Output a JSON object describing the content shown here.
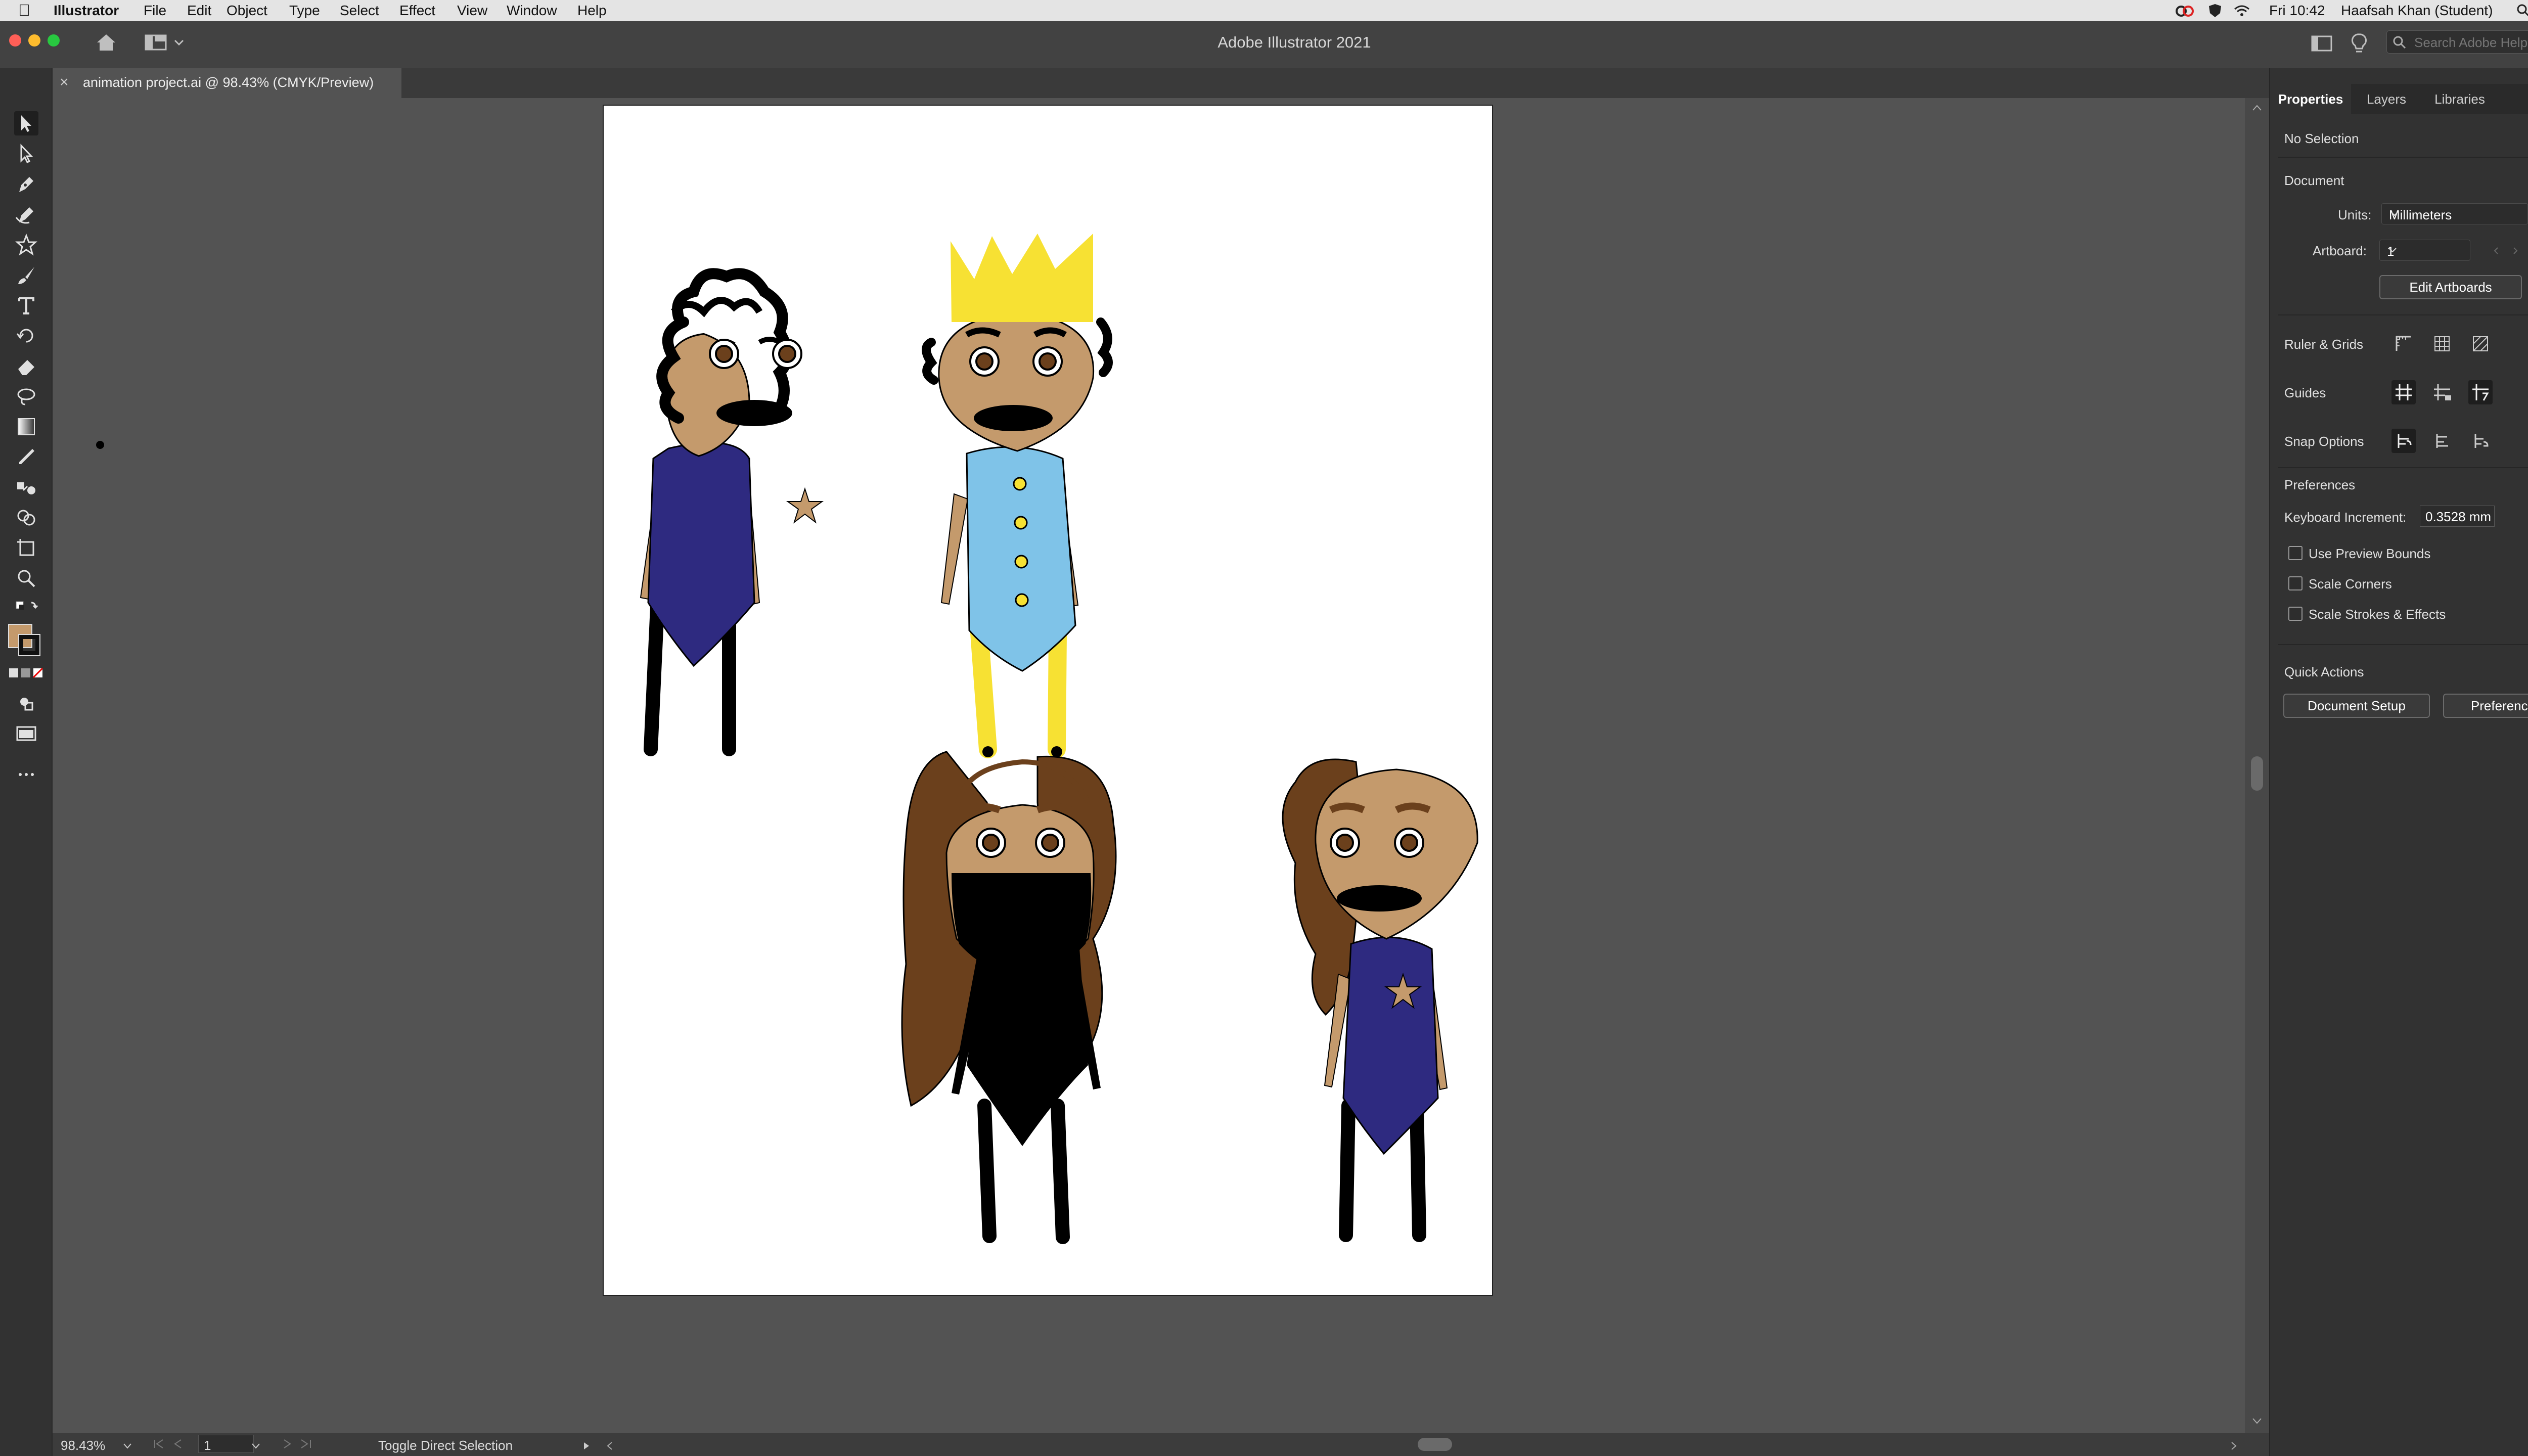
{
  "menubar": {
    "app": "Illustrator",
    "items": [
      "File",
      "Edit",
      "Object",
      "Type",
      "Select",
      "Effect",
      "View",
      "Window",
      "Help"
    ],
    "clock": "Fri 10:42",
    "user": "Haafsah Khan (Student)"
  },
  "window": {
    "title": "Adobe Illustrator 2021",
    "help_search_placeholder": "Search Adobe Help"
  },
  "document_tab": {
    "title": "animation project.ai @ 98.43% (CMYK/Preview)"
  },
  "tools": [
    "selection",
    "direct-selection",
    "pen",
    "curvature",
    "star",
    "paintbrush",
    "type",
    "rotate",
    "eraser",
    "lasso",
    "gradient",
    "eyedropper",
    "blend",
    "shape-builder",
    "artboard",
    "zoom"
  ],
  "panel": {
    "tabs": [
      "Properties",
      "Layers",
      "Libraries"
    ],
    "selection": "No Selection",
    "document": {
      "heading": "Document",
      "units_label": "Units:",
      "units_value": "Millimeters",
      "artboard_label": "Artboard:",
      "artboard_value": "1",
      "edit_artboards": "Edit Artboards"
    },
    "ruler_grids": "Ruler & Grids",
    "guides": "Guides",
    "snap_options": "Snap Options",
    "preferences": {
      "heading": "Preferences",
      "keyboard_increment_label": "Keyboard Increment:",
      "keyboard_increment_value": "0.3528 mm",
      "use_preview_bounds": "Use Preview Bounds",
      "scale_corners": "Scale Corners",
      "scale_strokes": "Scale Strokes & Effects"
    },
    "quick_actions": {
      "heading": "Quick Actions",
      "document_setup": "Document Setup",
      "preferences_button": "Preferences"
    }
  },
  "statusbar": {
    "zoom": "98.43%",
    "artboard": "1",
    "status": "Toggle Direct Selection"
  },
  "colors": {
    "skin": "#C49A6C",
    "shirt_navy": "#2E2A80",
    "shirt_light_blue": "#7FC3E8",
    "crown_yellow": "#F7E133",
    "hair_brown": "#6B401C",
    "ui_dark": "#323232",
    "canvas_gray": "#535353"
  }
}
